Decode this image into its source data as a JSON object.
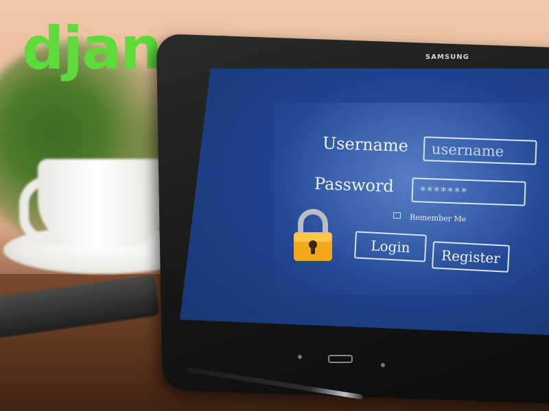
{
  "logo": {
    "text": "django",
    "color": "#5ddb3a"
  },
  "tablet": {
    "brand": "SAMSUNG"
  },
  "login_form": {
    "username_label": "Username",
    "username_placeholder": "username",
    "password_label": "Password",
    "password_value": "*******",
    "remember_me_label": "Remember Me",
    "login_button": "Login",
    "register_button": "Register"
  },
  "icons": {
    "lock": "padlock-icon",
    "checkbox": "checkbox-icon",
    "home": "home-button-icon"
  },
  "colors": {
    "screen_blue": "#1e438e",
    "lock_gold": "#f2a81d"
  }
}
